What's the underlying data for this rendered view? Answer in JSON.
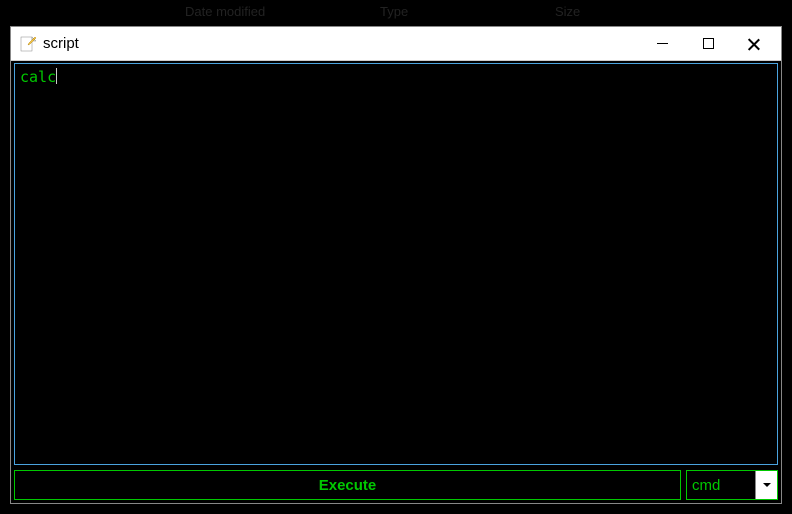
{
  "background": {
    "headers": {
      "date_modified": "Date modified",
      "type": "Type",
      "size": "Size"
    }
  },
  "window": {
    "title": "script",
    "editor": {
      "content": "calc"
    },
    "actions": {
      "execute_label": "Execute"
    },
    "mode": {
      "selected": "cmd"
    }
  }
}
